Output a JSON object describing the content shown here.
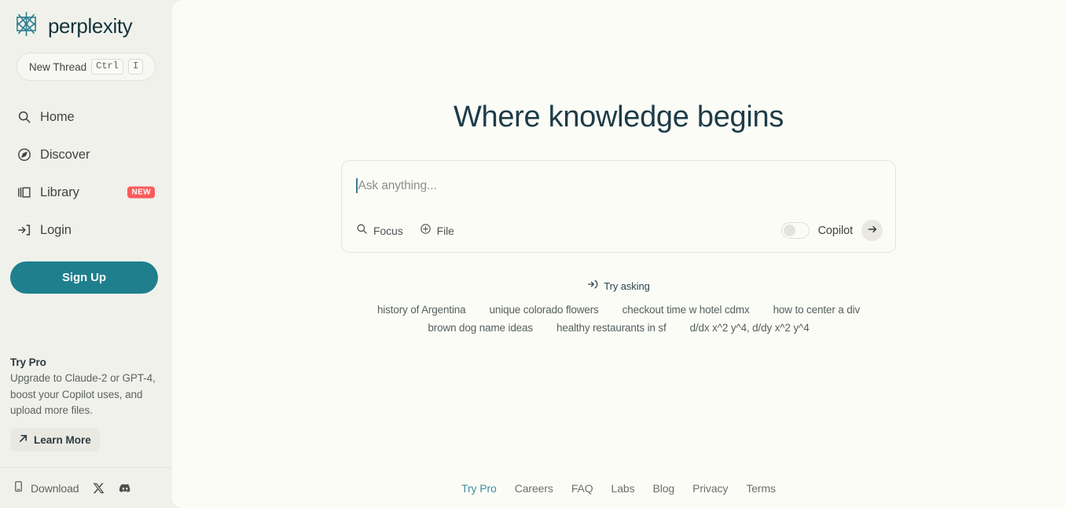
{
  "brand": {
    "name": "perplexity",
    "logo_icon": "perplexity-star-logo",
    "accent_color": "#1f7f8c"
  },
  "sidebar": {
    "new_thread": {
      "label": "New Thread",
      "key_modifier": "Ctrl",
      "key_letter": "I"
    },
    "nav": [
      {
        "label": "Home",
        "icon": "search-icon",
        "badge": null
      },
      {
        "label": "Discover",
        "icon": "compass-icon",
        "badge": null
      },
      {
        "label": "Library",
        "icon": "library-icon",
        "badge": "NEW"
      },
      {
        "label": "Login",
        "icon": "login-icon",
        "badge": null
      }
    ],
    "signup_label": "Sign Up",
    "try_pro": {
      "title": "Try Pro",
      "description": "Upgrade to Claude-2 or GPT-4, boost your Copilot uses, and upload more files.",
      "cta_label": "Learn More",
      "cta_icon": "arrow-up-right-icon"
    },
    "footer": {
      "download_label": "Download",
      "download_icon": "phone-icon",
      "social": [
        {
          "name": "x-twitter-icon"
        },
        {
          "name": "discord-icon"
        }
      ]
    },
    "badge_color": "#fb5a5a"
  },
  "main": {
    "hero_title": "Where knowledge begins",
    "ask": {
      "placeholder": "Ask anything...",
      "value": "",
      "focus_label": "Focus",
      "focus_icon": "search-icon",
      "file_label": "File",
      "file_icon": "plus-circle-icon",
      "copilot_label": "Copilot",
      "copilot_enabled": false,
      "submit_icon": "arrow-right-icon"
    },
    "try_asking": {
      "label": "Try asking",
      "icon": "arrow-into-bracket-icon",
      "rows": [
        [
          "history of Argentina",
          "unique colorado flowers",
          "checkout time w hotel cdmx",
          "how to center a div"
        ],
        [
          "brown dog name ideas",
          "healthy restaurants in sf",
          "d/dx x^2 y^4, d/dy x^2 y^4"
        ]
      ]
    },
    "footer_links": [
      {
        "label": "Try Pro",
        "accent": true
      },
      {
        "label": "Careers",
        "accent": false
      },
      {
        "label": "FAQ",
        "accent": false
      },
      {
        "label": "Labs",
        "accent": false
      },
      {
        "label": "Blog",
        "accent": false
      },
      {
        "label": "Privacy",
        "accent": false
      },
      {
        "label": "Terms",
        "accent": false
      }
    ]
  }
}
